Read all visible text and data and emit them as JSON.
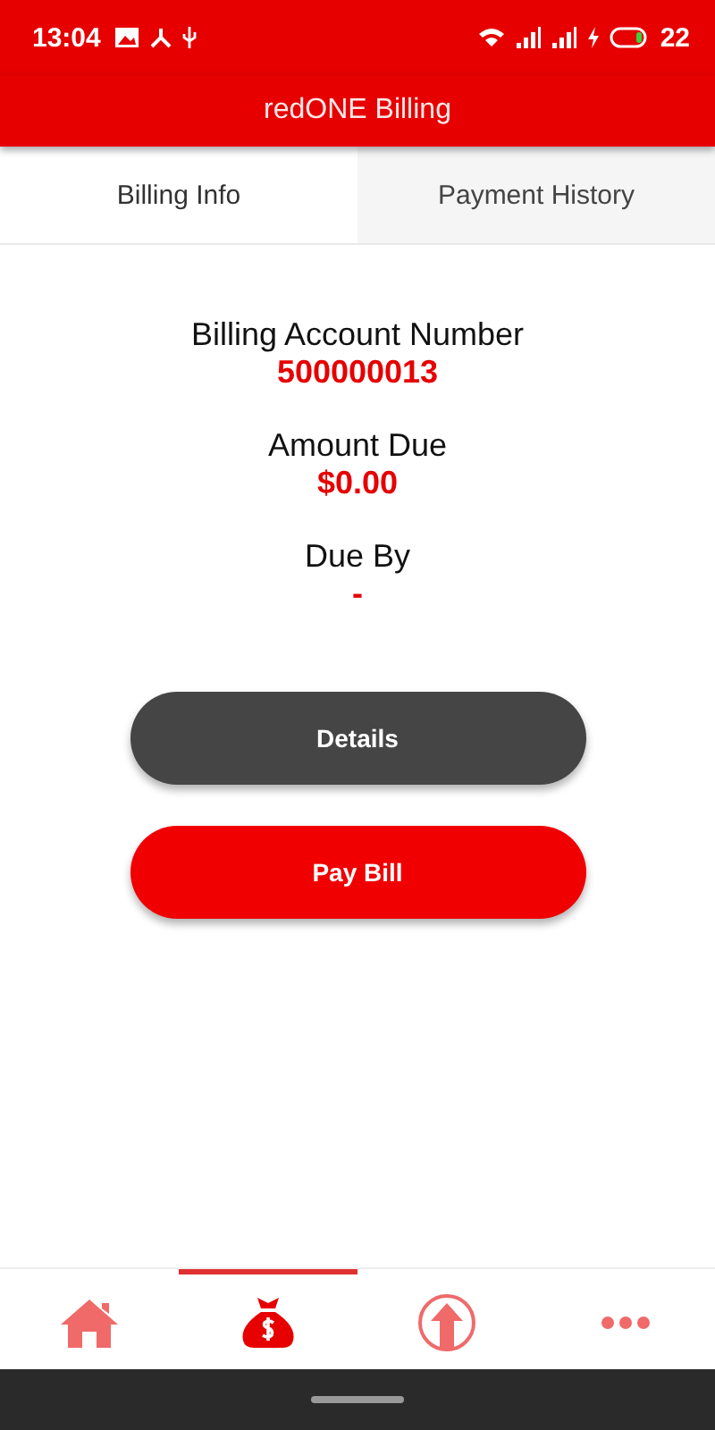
{
  "status_bar": {
    "time": "13:04",
    "battery": "22"
  },
  "app_bar": {
    "title": "redONE Billing"
  },
  "tabs": [
    {
      "label": "Billing Info",
      "selected": true
    },
    {
      "label": "Payment History",
      "selected": false
    }
  ],
  "fields": [
    {
      "label": "Billing Account Number",
      "value": "500000013"
    },
    {
      "label": "Amount Due",
      "value": "$0.00"
    },
    {
      "label": "Due By",
      "value": "-"
    }
  ],
  "buttons": [
    {
      "label": "Details",
      "kind": "secondary"
    },
    {
      "label": "Pay Bill",
      "kind": "primary"
    }
  ],
  "bottom_nav": [
    {
      "kind": "home",
      "selected": false
    },
    {
      "kind": "billing",
      "selected": true
    },
    {
      "kind": "upload",
      "selected": false
    },
    {
      "kind": "more",
      "selected": false
    }
  ]
}
